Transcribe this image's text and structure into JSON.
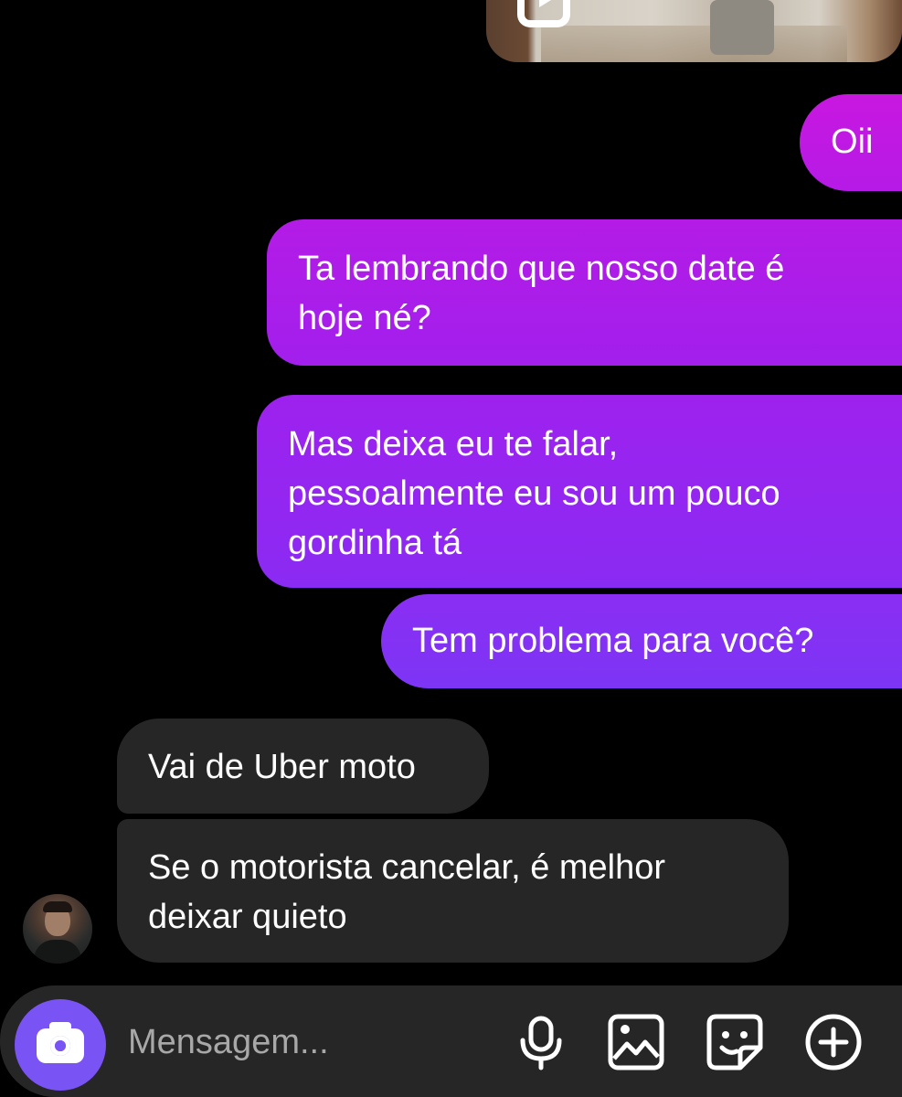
{
  "media_preview": {
    "icon": "reels-icon"
  },
  "messages": {
    "outgoing": [
      {
        "lines": [
          "Oii"
        ]
      },
      {
        "lines": [
          "Ta lembrando que nosso date é",
          "hoje né?"
        ]
      },
      {
        "lines": [
          "Mas deixa eu te falar,",
          "pessoalmente eu sou um pouco",
          "gordinha tá"
        ]
      },
      {
        "lines": [
          "Tem problema para você?"
        ]
      }
    ],
    "incoming": [
      {
        "lines": [
          "Vai de Uber moto"
        ]
      },
      {
        "lines": [
          "Se o motorista cancelar, é melhor",
          "deixar quieto"
        ]
      }
    ]
  },
  "composer": {
    "placeholder": "Mensagem...",
    "icons": [
      "camera-icon",
      "microphone-icon",
      "gallery-icon",
      "sticker-icon",
      "plus-circle-icon"
    ]
  },
  "colors": {
    "background": "#000000",
    "outgoing_bubble_top": "#c51be6",
    "outgoing_bubble_bottom": "#7d35f5",
    "incoming_bubble": "#262626",
    "camera_button": "#7a53f4"
  }
}
